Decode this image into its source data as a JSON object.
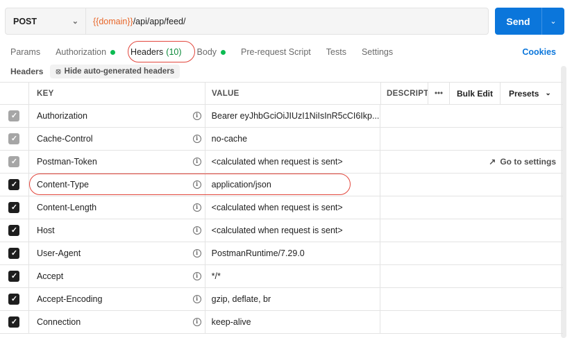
{
  "request": {
    "method": "POST",
    "url_variable": "{{domain}}",
    "url_path": "/api/app/feed/",
    "send_label": "Send"
  },
  "tabs": [
    {
      "label": "Params"
    },
    {
      "label": "Authorization"
    },
    {
      "label": "Headers",
      "count": "(10)"
    },
    {
      "label": "Body"
    },
    {
      "label": "Pre-request Script"
    },
    {
      "label": "Tests"
    },
    {
      "label": "Settings"
    }
  ],
  "cookies_label": "Cookies",
  "headers_section": {
    "label": "Headers",
    "hide_button": "Hide auto-generated headers"
  },
  "table": {
    "columns": {
      "key": "KEY",
      "value": "VALUE",
      "description": "DESCRIPTION",
      "more": "•••",
      "bulk_edit": "Bulk Edit",
      "presets": "Presets"
    },
    "rows": [
      {
        "key": "Authorization",
        "value": "Bearer eyJhbGciOiJIUzI1NiIsInR5cCI6Ikp...",
        "checked": true,
        "auto": true
      },
      {
        "key": "Cache-Control",
        "value": "no-cache",
        "checked": true,
        "auto": true
      },
      {
        "key": "Postman-Token",
        "value": "<calculated when request is sent>",
        "checked": true,
        "auto": true,
        "extra": "Go to settings"
      },
      {
        "key": "Content-Type",
        "value": "application/json",
        "checked": true,
        "auto": false
      },
      {
        "key": "Content-Length",
        "value": "<calculated when request is sent>",
        "checked": true,
        "auto": false
      },
      {
        "key": "Host",
        "value": "<calculated when request is sent>",
        "checked": true,
        "auto": false
      },
      {
        "key": "User-Agent",
        "value": "PostmanRuntime/7.29.0",
        "checked": true,
        "auto": false
      },
      {
        "key": "Accept",
        "value": "*/*",
        "checked": true,
        "auto": false
      },
      {
        "key": "Accept-Encoding",
        "value": "gzip, deflate, br",
        "checked": true,
        "auto": false
      },
      {
        "key": "Connection",
        "value": "keep-alive",
        "checked": true,
        "auto": false
      }
    ]
  },
  "colors": {
    "accent": "#0b76db",
    "annotation": "#e2463c",
    "variable": "#e8672a",
    "status_dot": "#0cbb52"
  }
}
